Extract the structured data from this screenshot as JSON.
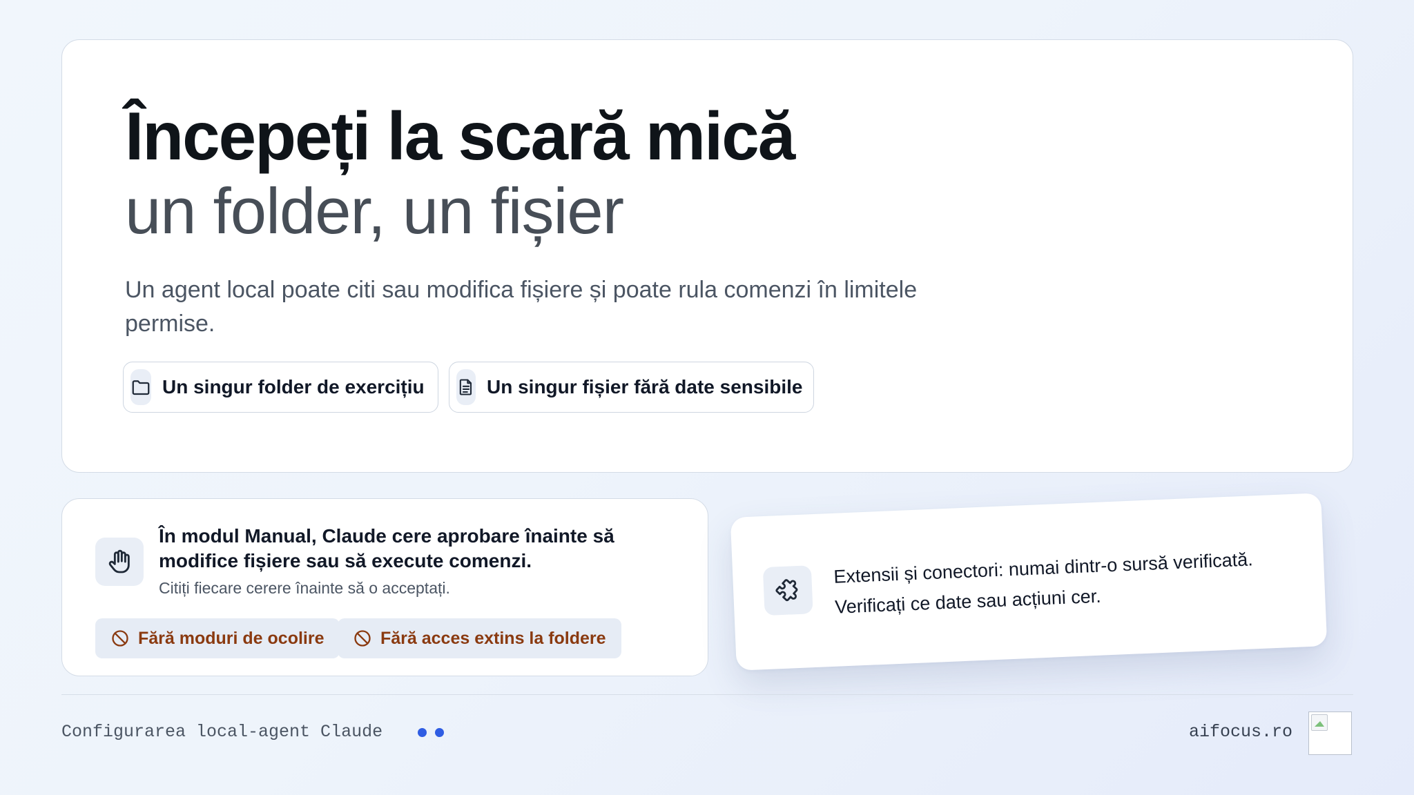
{
  "hero": {
    "title": "Începeți la scară mică",
    "subtitle": "un folder, un fișier",
    "description": "Un agent local poate citi sau modifica fișiere și poate rula comenzi în limitele permise.",
    "chips": [
      {
        "icon": "folder-icon",
        "label": "Un singur folder de exercițiu"
      },
      {
        "icon": "file-text-icon",
        "label": "Un singur fișier fără date sensibile"
      }
    ]
  },
  "manual_card": {
    "icon": "hand-stop-icon",
    "title": "În modul Manual, Claude cere aprobare înainte să modifice fișiere sau să execute comenzi.",
    "note": "Citiți fiecare cerere înainte să o acceptați.",
    "warnings": [
      {
        "icon": "ban-icon",
        "label": "Fără moduri de ocolire"
      },
      {
        "icon": "ban-icon",
        "label": "Fără acces extins la foldere"
      }
    ]
  },
  "extensions_card": {
    "icon": "puzzle-icon",
    "line1": "Extensii și conectori: numai dintr-o sursă verificată.",
    "line2": "Verificați ce date sau acțiuni cer."
  },
  "footer": {
    "left_text": "Configurarea local-agent Claude",
    "right_text": "aifocus.ro",
    "dot_color": "#2f5de3",
    "logo_alt": ""
  },
  "colors": {
    "accent": "#2f5de3",
    "warning_text": "#8a3a10",
    "warning_bg": "#e6ecf5",
    "icon_bg": "#e9eef6"
  }
}
